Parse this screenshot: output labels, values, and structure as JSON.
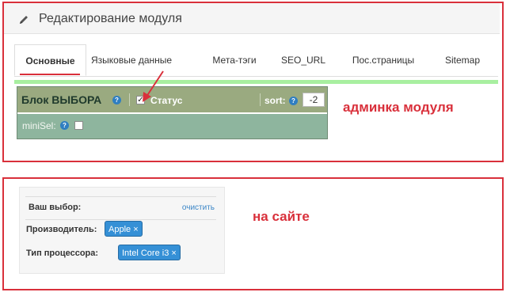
{
  "admin": {
    "title": "Редактирование модуля",
    "tabs": [
      "Основные",
      "Языковые данные",
      "Мета-тэги",
      "SEO_URL",
      "Пос.страницы",
      "Sitemap"
    ],
    "active_tab_index": 0,
    "module": {
      "block_title": "Блок ВЫБОРА",
      "status_label": "Статус",
      "status_checked": true,
      "sort_label": "sort:",
      "sort_value": "-2",
      "minisel_label": "miniSel:",
      "minisel_checked": false,
      "help_icon": "?"
    },
    "annotation": "админка модуля"
  },
  "site": {
    "title": "Ваш выбор:",
    "clear_link": "очистить",
    "rows": [
      {
        "label": "Производитель:",
        "chip": "Apple ×"
      },
      {
        "label": "Тип процессора:",
        "chip": "Intel Core i3 ×"
      }
    ],
    "annotation": "на сайте"
  },
  "colors": {
    "annotation_red": "#d9303b",
    "module_bg": "#8eb59e",
    "module_header_bg": "#9aaa80",
    "chip_blue": "#3590d6",
    "link_blue": "#3b86c7",
    "green_bar": "#a8efa0"
  },
  "icons": [
    "pencil-icon",
    "help-icon",
    "checkbox-icon",
    "arrow-icon",
    "remove-icon"
  ]
}
